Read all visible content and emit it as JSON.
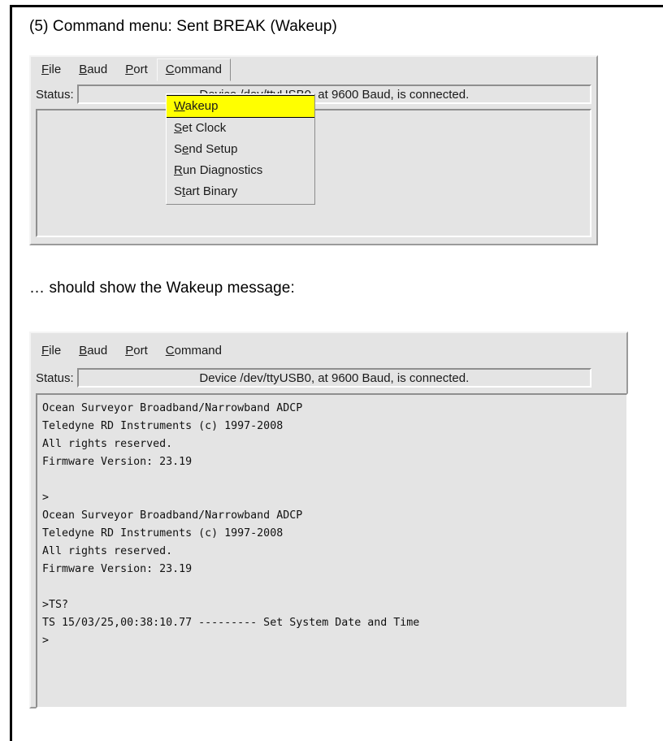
{
  "document": {
    "caption_top": "(5) Command menu: Sent BREAK  (Wakeup)",
    "caption_middle": "… should show the Wakeup message:"
  },
  "window_top": {
    "menubar": [
      {
        "name": "file",
        "pre": "",
        "mnemonic": "F",
        "post": "ile"
      },
      {
        "name": "baud",
        "pre": "",
        "mnemonic": "B",
        "post": "aud"
      },
      {
        "name": "port",
        "pre": "",
        "mnemonic": "P",
        "post": "ort"
      },
      {
        "name": "command",
        "pre": "",
        "mnemonic": "C",
        "post": "ommand"
      }
    ],
    "status": {
      "label": "Status:",
      "value": "Device /dev/ttyUSB0, at 9600 Baud, is connected."
    },
    "terminal_text": ""
  },
  "dropdown": {
    "open_for": "Command",
    "highlight_color": "#ffff00",
    "items": [
      {
        "name": "wakeup",
        "pre": "",
        "mnemonic": "W",
        "post": "akeup",
        "highlighted": true
      },
      {
        "name": "set-clock",
        "pre": "",
        "mnemonic": "S",
        "post": "et Clock",
        "highlighted": false
      },
      {
        "name": "send-setup",
        "pre": "S",
        "mnemonic": "e",
        "post": "nd Setup",
        "highlighted": false
      },
      {
        "name": "run-diagnostics",
        "pre": "",
        "mnemonic": "R",
        "post": "un Diagnostics",
        "highlighted": false
      },
      {
        "name": "start-binary",
        "pre": "S",
        "mnemonic": "t",
        "post": "art Binary",
        "highlighted": false
      }
    ]
  },
  "window_bottom": {
    "menubar": [
      {
        "name": "file",
        "pre": "",
        "mnemonic": "F",
        "post": "ile"
      },
      {
        "name": "baud",
        "pre": "",
        "mnemonic": "B",
        "post": "aud"
      },
      {
        "name": "port",
        "pre": "",
        "mnemonic": "P",
        "post": "ort"
      },
      {
        "name": "command",
        "pre": "",
        "mnemonic": "C",
        "post": "ommand"
      }
    ],
    "status": {
      "label": "Status:",
      "value": "Device /dev/ttyUSB0, at 9600 Baud, is connected."
    },
    "terminal_text": "Ocean Surveyor Broadband/Narrowband ADCP\nTeledyne RD Instruments (c) 1997-2008\nAll rights reserved.\nFirmware Version: 23.19\n\n>\nOcean Surveyor Broadband/Narrowband ADCP\nTeledyne RD Instruments (c) 1997-2008\nAll rights reserved.\nFirmware Version: 23.19\n\n>TS?\nTS 15/03/25,00:38:10.77 --------- Set System Date and Time\n>"
  }
}
